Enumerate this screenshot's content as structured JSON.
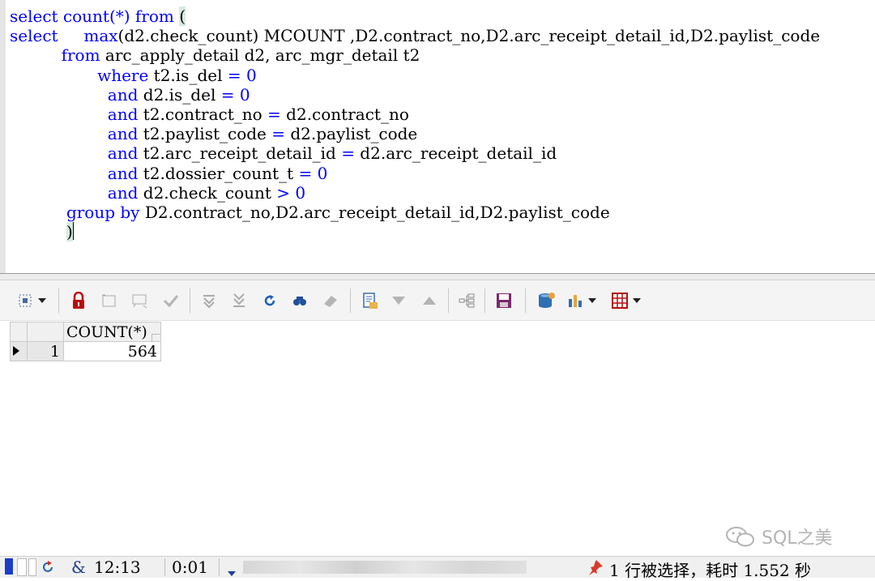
{
  "editor": {
    "lines": [
      [
        [
          "kw",
          "select count(*) from "
        ],
        [
          "hl",
          "("
        ]
      ],
      [
        [
          "kw",
          "select"
        ],
        [
          "t",
          "     "
        ],
        [
          "kw",
          "max"
        ],
        [
          "t",
          "(d2.check_count) MCOUNT ,D2.contract_no,D2.arc_receipt_detail_id,D2.paylist_code"
        ]
      ],
      [
        [
          "t",
          "          "
        ],
        [
          "kw",
          "from"
        ],
        [
          "t",
          " arc_apply_detail d2, arc_mgr_detail t2"
        ]
      ],
      [
        [
          "t",
          "                 "
        ],
        [
          "kw",
          "where"
        ],
        [
          "t",
          " t2.is_del "
        ],
        [
          "op",
          "="
        ],
        [
          "t",
          " "
        ],
        [
          "num",
          "0"
        ]
      ],
      [
        [
          "t",
          "                   "
        ],
        [
          "kw",
          "and"
        ],
        [
          "t",
          " d2.is_del "
        ],
        [
          "op",
          "="
        ],
        [
          "t",
          " "
        ],
        [
          "num",
          "0"
        ]
      ],
      [
        [
          "t",
          "                   "
        ],
        [
          "kw",
          "and"
        ],
        [
          "t",
          " t2.contract_no "
        ],
        [
          "op",
          "="
        ],
        [
          "t",
          " d2.contract_no"
        ]
      ],
      [
        [
          "t",
          "                   "
        ],
        [
          "kw",
          "and"
        ],
        [
          "t",
          " t2.paylist_code "
        ],
        [
          "op",
          "="
        ],
        [
          "t",
          " d2.paylist_code"
        ]
      ],
      [
        [
          "t",
          "                   "
        ],
        [
          "kw",
          "and"
        ],
        [
          "t",
          " t2.arc_receipt_detail_id "
        ],
        [
          "op",
          "="
        ],
        [
          "t",
          " d2.arc_receipt_detail_id"
        ]
      ],
      [
        [
          "t",
          "                   "
        ],
        [
          "kw",
          "and"
        ],
        [
          "t",
          " t2.dossier_count_t "
        ],
        [
          "op",
          "="
        ],
        [
          "t",
          " "
        ],
        [
          "num",
          "0"
        ]
      ],
      [
        [
          "t",
          "                   "
        ],
        [
          "kw",
          "and"
        ],
        [
          "t",
          " d2.check_count "
        ],
        [
          "op",
          ">"
        ],
        [
          "t",
          " "
        ],
        [
          "num",
          "0"
        ]
      ],
      [
        [
          "t",
          "           "
        ],
        [
          "kw",
          "group by"
        ],
        [
          "t",
          " D2.contract_no,D2.arc_receipt_detail_id,D2.paylist_code"
        ]
      ],
      [
        [
          "t",
          "           "
        ],
        [
          "hl",
          ")"
        ],
        [
          "caret",
          ""
        ]
      ]
    ]
  },
  "toolbar": {
    "icons": [
      "grid-select-icon",
      "lock-icon",
      "insert-record-icon",
      "delete-record-icon",
      "post-check-icon",
      "first-record-icon",
      "last-record-icon",
      "refresh-icon",
      "find-icon",
      "clear-icon",
      "export-icon",
      "filter-down-icon",
      "filter-up-icon",
      "tree-icon",
      "save-icon",
      "database-icon",
      "chart-icon",
      "table-grid-icon"
    ]
  },
  "grid": {
    "column_header": "COUNT(*)",
    "rows": [
      {
        "row_number": "1",
        "value": "564"
      }
    ]
  },
  "statusbar": {
    "cursor_pos": "12:13",
    "elapsed": "0:01",
    "selection_text": "1 行被选择，耗时 1.552 秒"
  },
  "watermark": "SQL之美",
  "colors": {
    "keyword": "#0000ff",
    "bracket_highlight": "#d5ebe0",
    "red_icon": "#b80f0f"
  }
}
